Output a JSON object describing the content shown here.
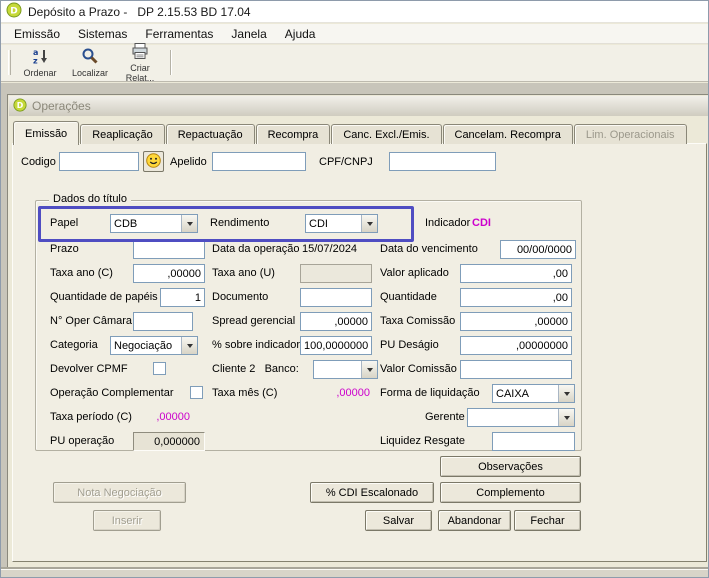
{
  "app": {
    "title": "Depósito a Prazo -   DP 2.15.53 BD 17.04",
    "menu": [
      "Emissão",
      "Sistemas",
      "Ferramentas",
      "Janela",
      "Ajuda"
    ],
    "toolbar": [
      "Ordenar",
      "Localizar",
      "Criar Relat..."
    ]
  },
  "child": {
    "title": "Operações",
    "tabs": [
      "Emissão",
      "Reaplicação",
      "Repactuação",
      "Recompra",
      "Canc. Excl./Emis.",
      "Cancelam. Recompra",
      "Lim. Operacionais"
    ]
  },
  "header": {
    "codigo": {
      "label": "Codigo",
      "value": ""
    },
    "apelido": {
      "label": "Apelido",
      "value": ""
    },
    "cpf_cnpj": {
      "label": "CPF/CNPJ",
      "value": ""
    }
  },
  "group": {
    "legend": "Dados do título"
  },
  "fields": {
    "papel": {
      "label": "Papel",
      "value": "CDB"
    },
    "rendimento": {
      "label": "Rendimento",
      "value": "CDI"
    },
    "indicador": {
      "label": "Indicador",
      "value": "CDI"
    },
    "prazo": {
      "label": "Prazo",
      "value": ""
    },
    "data_operacao": {
      "label": "Data da operação",
      "value": "15/07/2024"
    },
    "data_vencimento": {
      "label": "Data do vencimento",
      "value": "00/00/0000"
    },
    "taxa_ano_c": {
      "label": "Taxa ano (C)",
      "value": ",00000"
    },
    "taxa_ano_u": {
      "label": "Taxa ano (U)",
      "value": ""
    },
    "valor_aplicado": {
      "label": "Valor aplicado",
      "value": ",00"
    },
    "qtd_papeis": {
      "label": "Quantidade de papéis",
      "value": "1"
    },
    "documento": {
      "label": "Documento",
      "value": ""
    },
    "quantidade": {
      "label": "Quantidade",
      "value": ",00"
    },
    "oper_camara": {
      "label": "N° Oper Câmara",
      "value": ""
    },
    "spread_gerencial": {
      "label": "Spread gerencial",
      "value": ",00000"
    },
    "taxa_comissao": {
      "label": "Taxa Comissão",
      "value": ",00000"
    },
    "categoria": {
      "label": "Categoria",
      "value": "Negociação"
    },
    "sobre_indicador": {
      "label": "% sobre indicador",
      "value": "100,0000000"
    },
    "pu_desagio": {
      "label": "PU Deságio",
      "value": ",00000000"
    },
    "devolver_cpmf": {
      "label": "Devolver CPMF",
      "checked": false
    },
    "cliente2_banco": {
      "label": "Cliente 2   Banco:",
      "value": ""
    },
    "valor_comissao": {
      "label": "Valor Comissão",
      "value": ""
    },
    "op_complementar": {
      "label": "Operação Complementar",
      "checked": false
    },
    "taxa_mes_c": {
      "label": "Taxa mês (C)",
      "value": ",00000"
    },
    "forma_liquidacao": {
      "label": "Forma de liquidação",
      "value": "CAIXA"
    },
    "taxa_periodo_c": {
      "label": "Taxa período (C)",
      "value": ",00000"
    },
    "gerente": {
      "label": "Gerente",
      "value": ""
    },
    "pu_operacao": {
      "label": "PU operação",
      "value": "0,000000"
    },
    "liquidez_resgate": {
      "label": "Liquidez Resgate",
      "value": ""
    }
  },
  "buttons": {
    "observacoes": "Observações",
    "nota_negociacao": "Nota Negociação",
    "cdi_escalonado": "% CDI Escalonado",
    "complemento": "Complemento",
    "inserir": "Inserir",
    "salvar": "Salvar",
    "abandonar": "Abandonar",
    "fechar": "Fechar"
  },
  "colors": {
    "highlight_box": "#4f4dc2",
    "indicator_text": "#cc00cc"
  }
}
